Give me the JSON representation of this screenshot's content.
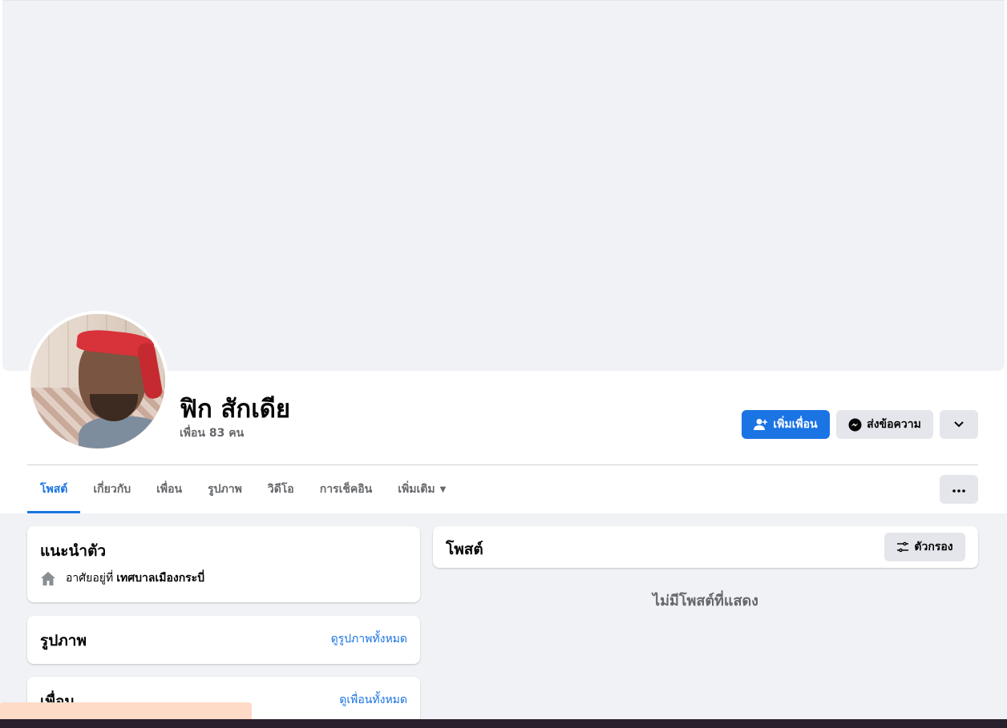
{
  "profile": {
    "name": "ฟิก สักเดีย",
    "friends": "เพื่อน 83 คน"
  },
  "actions": {
    "add_friend": "เพิ่มเพื่อน",
    "message": "ส่งข้อความ"
  },
  "tabs": [
    {
      "label": "โพสต์",
      "active": true
    },
    {
      "label": "เกี่ยวกับ"
    },
    {
      "label": "เพื่อน"
    },
    {
      "label": "รูปภาพ"
    },
    {
      "label": "วิดีโอ"
    },
    {
      "label": "การเช็คอิน"
    },
    {
      "label": "เพิ่มเติม"
    }
  ],
  "intro": {
    "title": "แนะนำตัว",
    "lives_prefix": "อาศัยอยู่ที่",
    "lives_place": "เทศบาลเมืองกระบี่"
  },
  "photos": {
    "title": "รูปภาพ",
    "link": "ดูรูปภาพทั้งหมด"
  },
  "friends_card": {
    "title": "เพื่อน",
    "link": "ดูเพื่อนทั้งหมด"
  },
  "posts": {
    "title": "โพสต์",
    "filter": "ตัวกรอง",
    "empty": "ไม่มีโพสต์ที่แสดง"
  },
  "colors": {
    "primary": "#1b74e4",
    "secondary_button": "#e4e6eb",
    "page_background": "#f0f2f5"
  }
}
